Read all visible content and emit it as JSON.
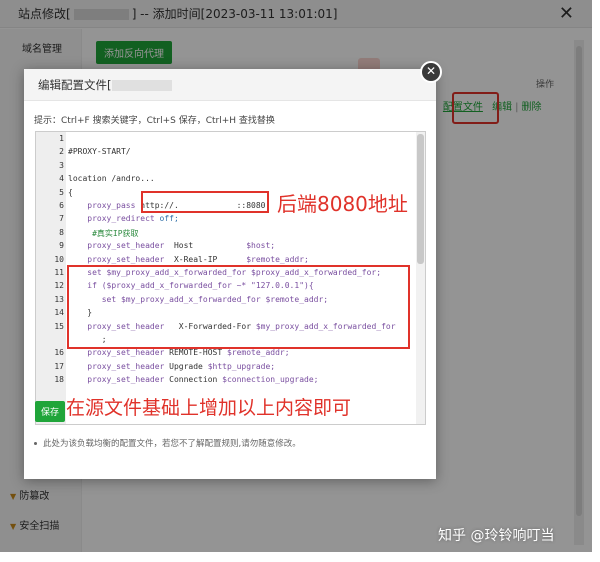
{
  "outer_dialog": {
    "title_prefix": "站点修改[",
    "title_suffix": "] -- 添加时间[2023-03-11 13:01:01]",
    "close_glyph": "✕",
    "nav": {
      "domain_mgmt": "域名管理",
      "tamper_proof": "防篡改",
      "security_scan": "安全扫描"
    },
    "add_proxy_button": "添加反向代理",
    "ops_header": "操作",
    "row_ops": {
      "config_file": "配置文件",
      "edit": "编辑",
      "separator": "|",
      "delete": "删除"
    }
  },
  "modal": {
    "title": "编辑配置文件[",
    "close_glyph": "✕",
    "tip": "提示：Ctrl+F 搜索关键字，Ctrl+S 保存，Ctrl+H 查找替换",
    "save_button": "保存",
    "note": "此处为该负载均衡的配置文件，若您不了解配置规则,请勿随意修改。"
  },
  "editor": {
    "lines": [
      {
        "n": "1",
        "parts": []
      },
      {
        "n": "2",
        "parts": [
          {
            "t": "#PROXY-START/",
            "c": ""
          }
        ]
      },
      {
        "n": "3",
        "parts": []
      },
      {
        "n": "4",
        "parts": [
          {
            "t": "location /andro...",
            "c": ""
          }
        ]
      },
      {
        "n": "5",
        "parts": [
          {
            "t": "{",
            "c": ""
          }
        ]
      },
      {
        "n": "6",
        "parts": [
          {
            "t": "    proxy_pass ",
            "c": "k"
          },
          {
            "t": "http://.            ::8080;",
            "c": ""
          }
        ]
      },
      {
        "n": "7",
        "parts": [
          {
            "t": "    proxy_redirect ",
            "c": "k"
          },
          {
            "t": "off;",
            "c": "g"
          }
        ]
      },
      {
        "n": "8",
        "parts": [
          {
            "t": "     #真实IP获取",
            "c": "c"
          }
        ]
      },
      {
        "n": "9",
        "parts": [
          {
            "t": "    proxy_set_header ",
            "c": "k"
          },
          {
            "t": " Host           ",
            "c": ""
          },
          {
            "t": "$host;",
            "c": "v"
          }
        ]
      },
      {
        "n": "10",
        "parts": [
          {
            "t": "    proxy_set_header ",
            "c": "k"
          },
          {
            "t": " X-Real-IP      ",
            "c": ""
          },
          {
            "t": "$remote_addr;",
            "c": "v"
          }
        ]
      },
      {
        "n": "11",
        "parts": [
          {
            "t": "    set $my_proxy_add_x_forwarded_for $proxy_add_x_forwarded_for;",
            "c": "k"
          }
        ]
      },
      {
        "n": "12",
        "parts": [
          {
            "t": "    if ($proxy_add_x_forwarded_for ~* \"127.0.0.1\"){",
            "c": "k"
          }
        ]
      },
      {
        "n": "13",
        "parts": [
          {
            "t": "       set $my_proxy_add_x_forwarded_for $remote_addr;",
            "c": "k"
          }
        ]
      },
      {
        "n": "14",
        "parts": [
          {
            "t": "    }",
            "c": ""
          }
        ]
      },
      {
        "n": "15",
        "parts": [
          {
            "t": "    proxy_set_header ",
            "c": "k"
          },
          {
            "t": "  X-Forwarded-For ",
            "c": ""
          },
          {
            "t": "$my_proxy_add_x_forwarded_for",
            "c": "v"
          }
        ]
      },
      {
        "n": "",
        "parts": [
          {
            "t": "       ;",
            "c": ""
          }
        ]
      },
      {
        "n": "16",
        "parts": [
          {
            "t": "    proxy_set_header ",
            "c": "k"
          },
          {
            "t": "REMOTE-HOST ",
            "c": ""
          },
          {
            "t": "$remote_addr;",
            "c": "v"
          }
        ]
      },
      {
        "n": "17",
        "parts": [
          {
            "t": "    proxy_set_header ",
            "c": "k"
          },
          {
            "t": "Upgrade ",
            "c": ""
          },
          {
            "t": "$http_upgrade;",
            "c": "v"
          }
        ]
      },
      {
        "n": "18",
        "parts": [
          {
            "t": "    proxy_set_header ",
            "c": "k"
          },
          {
            "t": "Connection ",
            "c": ""
          },
          {
            "t": "$connection_upgrade;",
            "c": "v"
          }
        ]
      }
    ]
  },
  "annotations": {
    "backend": "后端8080地址",
    "add_content": "在源文件基础上增加以上内容即可"
  },
  "watermark": "知乎 @玲铃响叮当",
  "colors": {
    "accent_green": "#20a53a",
    "annotation_red": "#e0322a"
  }
}
